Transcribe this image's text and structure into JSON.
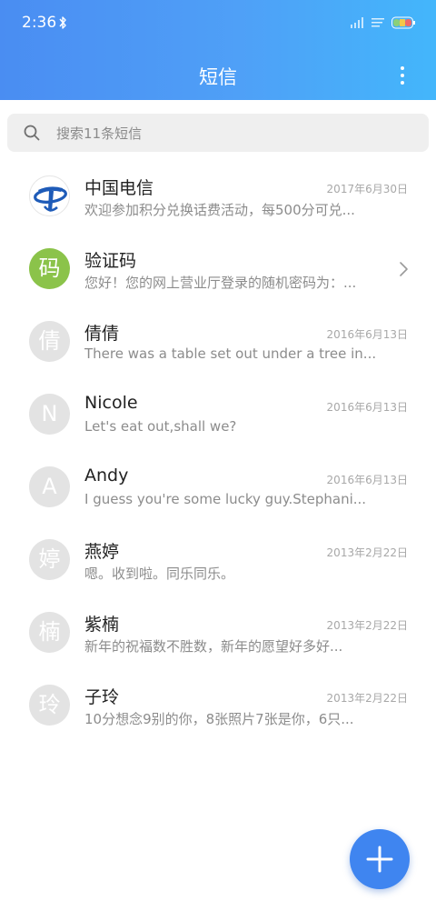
{
  "status_bar": {
    "time": "2:36"
  },
  "header": {
    "title": "短信"
  },
  "search": {
    "placeholder": "搜索11条短信"
  },
  "conversations": [
    {
      "avatar": "",
      "avatar_type": "china-telecom-logo",
      "name": "中国电信",
      "date": "2017年6月30日",
      "preview": "欢迎参加积分兑换话费活动，每500分可兑..."
    },
    {
      "avatar": "码",
      "avatar_color": "#8bc34a",
      "name": "验证码",
      "date": "",
      "preview": "您好！您的网上营业厅登录的随机密码为：...",
      "has_chevron": true
    },
    {
      "avatar": "倩",
      "name": "倩倩",
      "date": "2016年6月13日",
      "preview": "There was a table set out under a tree in..."
    },
    {
      "avatar": "N",
      "name": "Nicole",
      "date": "2016年6月13日",
      "preview": "Let's eat out,shall we?"
    },
    {
      "avatar": "A",
      "name": "Andy",
      "date": "2016年6月13日",
      "preview": "I guess you're some lucky guy.Stephani..."
    },
    {
      "avatar": "婷",
      "name": "燕婷",
      "date": "2013年2月22日",
      "preview": "嗯。收到啦。同乐同乐。"
    },
    {
      "avatar": "楠",
      "name": "紫楠",
      "date": "2013年2月22日",
      "preview": "新年的祝福数不胜数，新年的愿望好多好..."
    },
    {
      "avatar": "玲",
      "name": "子玲",
      "date": "2013年2月22日",
      "preview": "10分想念9别的你，8张照片7张是你，6只..."
    }
  ],
  "colors": {
    "header_start": "#4a8df2",
    "header_end": "#43b6fb",
    "fab": "#3f85f0",
    "verify_avatar": "#8bc34a",
    "avatar_default": "#e3e3e3"
  },
  "icons": [
    "bluetooth-icon",
    "signal-icon",
    "wifi-icon",
    "battery-icon",
    "more-icon",
    "search-icon",
    "chevron-right-icon",
    "plus-icon"
  ]
}
